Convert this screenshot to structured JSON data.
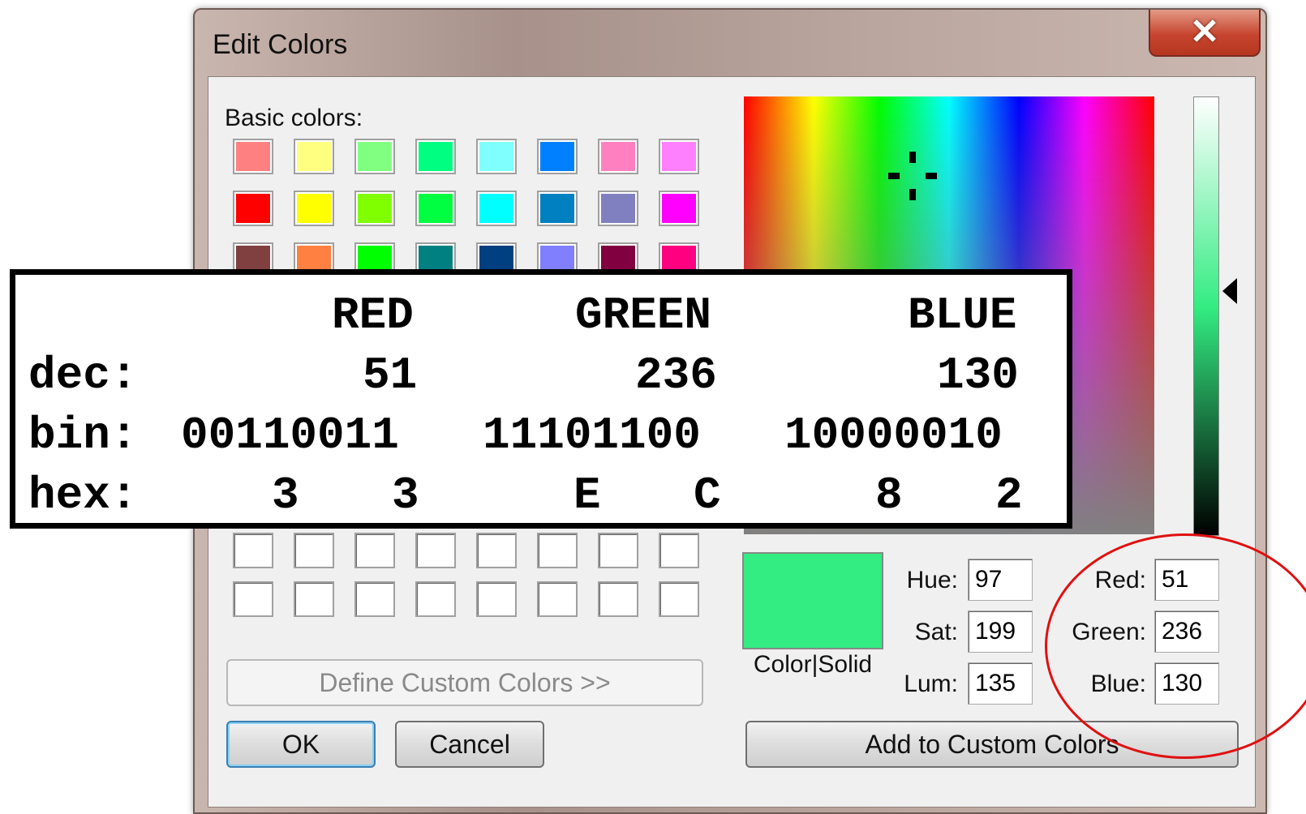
{
  "window": {
    "title": "Edit Colors",
    "close_glyph": "✕"
  },
  "basic_colors": {
    "label": "Basic colors:",
    "rows": [
      [
        "#ff8080",
        "#ffff80",
        "#80ff80",
        "#00ff80",
        "#80ffff",
        "#0080ff",
        "#ff80c0",
        "#ff80ff"
      ],
      [
        "#ff0000",
        "#ffff00",
        "#80ff00",
        "#00ff40",
        "#00ffff",
        "#0080c0",
        "#8080c0",
        "#ff00ff"
      ],
      [
        "#804040",
        "#ff8040",
        "#00ff00",
        "#008080",
        "#004080",
        "#8080ff",
        "#800040",
        "#ff0080"
      ]
    ]
  },
  "custom_colors": {
    "rows": 2,
    "cols": 8
  },
  "define_button": "Define Custom Colors >>",
  "ok_button": "OK",
  "cancel_button": "Cancel",
  "preview": {
    "color": "#33ec82",
    "label": "Color|Solid"
  },
  "hsl": {
    "hue_label": "Hue:",
    "hue": "97",
    "sat_label": "Sat:",
    "sat": "199",
    "lum_label": "Lum:",
    "lum": "135"
  },
  "rgb": {
    "red_label": "Red:",
    "red": "51",
    "green_label": "Green:",
    "green": "236",
    "blue_label": "Blue:",
    "blue": "130"
  },
  "add_button": "Add to Custom Colors",
  "overlay": {
    "headers": {
      "red": "RED",
      "green": "GREEN",
      "blue": "BLUE"
    },
    "dec": {
      "label": "dec:",
      "red": "51",
      "green": "236",
      "blue": "130"
    },
    "bin": {
      "label": "bin:",
      "red": "00110011",
      "green": "11101100",
      "blue": "10000010"
    },
    "hex": {
      "label": "hex:",
      "red_hi": "3",
      "red_lo": "3",
      "green_hi": "E",
      "green_lo": "C",
      "blue_hi": "8",
      "blue_lo": "2"
    }
  }
}
